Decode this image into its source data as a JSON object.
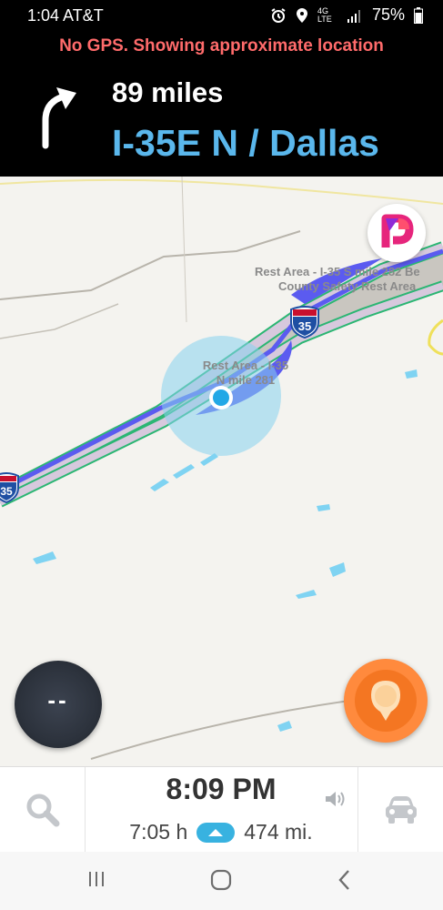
{
  "status_bar": {
    "time_carrier": "1:04 AT&T",
    "network": "4G LTE",
    "battery": "75%"
  },
  "navigation": {
    "warning": "No GPS. Showing approximate location",
    "distance": "89 miles",
    "road": "I-35E N / Dallas",
    "turn_icon": "turn-right-icon"
  },
  "map": {
    "labels": {
      "rest_area_south": "Rest Area - I-35 S mile 282 Be",
      "rest_area_south_line2": "County Safety Rest Area",
      "rest_area_north": "Rest Area - I-35",
      "rest_area_north_line2": "N mile 281"
    },
    "shields": {
      "main": "35",
      "left": "35"
    }
  },
  "speed": {
    "value": "--"
  },
  "bottom": {
    "eta": "8:09 PM",
    "duration": "7:05 h",
    "distance": "474 mi."
  },
  "colors": {
    "route": "#5b5bf0",
    "road_edge": "#2bb673",
    "accent": "#38b2e0",
    "report": "#f47622"
  }
}
